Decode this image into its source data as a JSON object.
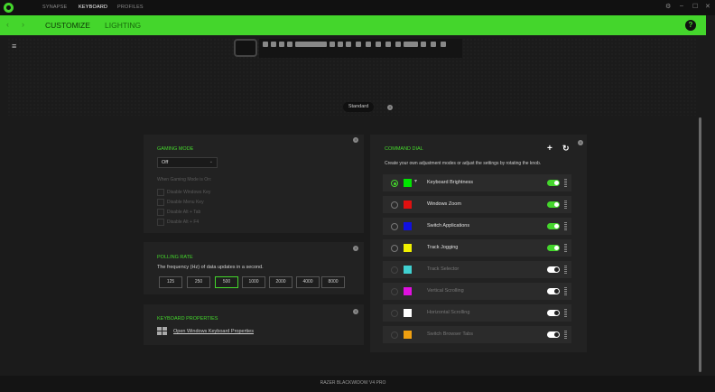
{
  "titlebar": {
    "tabs": [
      {
        "label": "SYNAPSE",
        "active": false
      },
      {
        "label": "KEYBOARD",
        "active": true
      },
      {
        "label": "PROFILES",
        "active": false
      }
    ],
    "icons": [
      "settings-icon",
      "minimize-icon",
      "maximize-icon",
      "close-icon"
    ]
  },
  "nav": {
    "tabs": [
      {
        "label": "CUSTOMIZE",
        "active": true
      },
      {
        "label": "LIGHTING",
        "active": false
      }
    ],
    "help_label": "?"
  },
  "profile_button": "Standard",
  "gaming_mode": {
    "title": "GAMING MODE",
    "selected": "Off",
    "subtitle": "When Gaming Mode is On:",
    "options": [
      "Disable Windows Key",
      "Disable Menu Key",
      "Disable Alt + Tab",
      "Disable Alt + F4"
    ]
  },
  "polling_rate": {
    "title": "POLLING RATE",
    "description": "The frequency (Hz) of data updates in a second.",
    "rates": [
      "125",
      "250",
      "500",
      "1000",
      "2000",
      "4000",
      "8000"
    ],
    "selected": "500"
  },
  "keyboard_properties": {
    "title": "KEYBOARD PROPERTIES",
    "link": "Open Windows Keyboard Properties"
  },
  "command_dial": {
    "title": "COMMAND DIAL",
    "description": "Create your own adjustment modes or adjust the settings by rotating the knob.",
    "items": [
      {
        "label": "Keyboard Brightness",
        "color": "#00e600",
        "enabled": true,
        "selected": true
      },
      {
        "label": "Windows Zoom",
        "color": "#e01010",
        "enabled": true,
        "selected": false
      },
      {
        "label": "Switch Applications",
        "color": "#1010e0",
        "enabled": true,
        "selected": false
      },
      {
        "label": "Track Jogging",
        "color": "#f0f000",
        "enabled": true,
        "selected": false
      },
      {
        "label": "Track Selector",
        "color": "#40d0d0",
        "enabled": false,
        "selected": false
      },
      {
        "label": "Vertical Scrolling",
        "color": "#e010e0",
        "enabled": false,
        "selected": false
      },
      {
        "label": "Horizontal Scrolling",
        "color": "#ffffff",
        "enabled": false,
        "selected": false
      },
      {
        "label": "Switch Browser Tabs",
        "color": "#f0a010",
        "enabled": false,
        "selected": false
      }
    ]
  },
  "footer": {
    "device": "RAZER BLACKWIDOW V4 PRO"
  },
  "colors": {
    "accent": "#44d62c",
    "background": "#1b1b1b",
    "panel": "#222222"
  }
}
